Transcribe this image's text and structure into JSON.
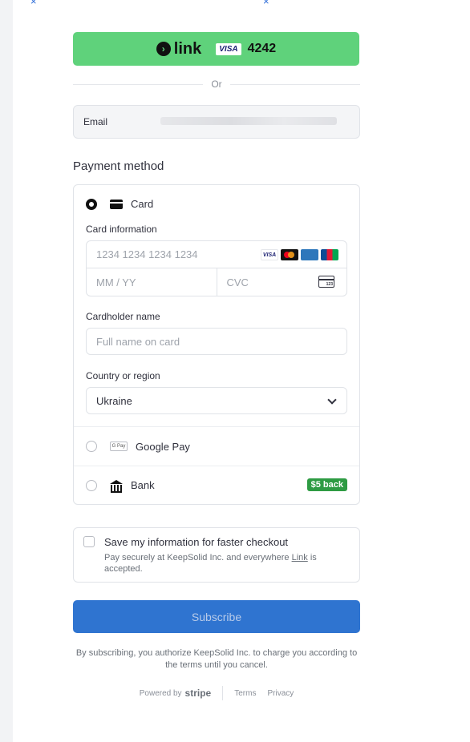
{
  "link": {
    "logo_text": "link",
    "card_brand": "VISA",
    "last4": "4242"
  },
  "divider": {
    "or_text": "Or"
  },
  "email": {
    "label": "Email"
  },
  "payment": {
    "title": "Payment method",
    "card": {
      "label": "Card",
      "info_label": "Card information",
      "number_placeholder": "1234 1234 1234 1234",
      "expiry_placeholder": "MM / YY",
      "cvc_placeholder": "CVC",
      "cvc_icon_text": "123",
      "brands": [
        "VISA",
        "mastercard",
        "amex",
        "jcb"
      ],
      "holder_label": "Cardholder name",
      "holder_placeholder": "Full name on card",
      "country_label": "Country or region",
      "country_value": "Ukraine"
    },
    "gpay": {
      "label": "Google Pay",
      "icon_text": "G Pay"
    },
    "bank": {
      "label": "Bank",
      "badge": "$5 back"
    }
  },
  "save": {
    "title": "Save my information for faster checkout",
    "desc_before": "Pay securely at KeepSolid Inc. and everywhere ",
    "desc_link": "Link",
    "desc_after": " is accepted."
  },
  "subscribe": {
    "label": "Subscribe"
  },
  "legal": {
    "text": "By subscribing, you authorize KeepSolid Inc. to charge you according to the terms until you cancel."
  },
  "footer": {
    "powered": "Powered by",
    "stripe": "stripe",
    "terms": "Terms",
    "privacy": "Privacy"
  },
  "colors": {
    "link_green": "#5fd27b",
    "subscribe_blue": "#2f74d0",
    "badge_green": "#2e9b43"
  }
}
